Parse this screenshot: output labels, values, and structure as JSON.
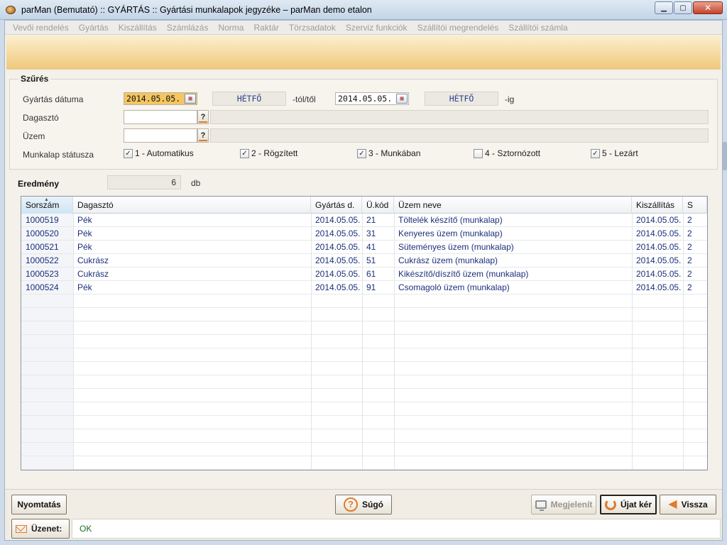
{
  "window": {
    "title": "parMan (Bemutató) :: GYÁRTÁS :: Gyártási munkalapok jegyzéke   –   parMan demo etalon",
    "minimize": "▁",
    "maximize": "▢",
    "close": "✕"
  },
  "menu": [
    "Vevői rendelés",
    "Gyártás",
    "Kiszállítás",
    "Számlázás",
    "Norma",
    "Raktár",
    "Törzsadatok",
    "Szerviz funkciók",
    "Szállítói megrendelés",
    "Szállítói számla"
  ],
  "filter": {
    "title": "Szűrés",
    "date_label": "Gyártás dátuma",
    "date_from": "2014.05.05.",
    "day_from": "HÉTFŐ",
    "from_suffix": "-tól/től",
    "date_to": "2014.05.05.",
    "day_to": "HÉTFŐ",
    "to_suffix": "-ig",
    "kneader_label": "Dagasztó",
    "kneader_value": "",
    "plant_label": "Üzem",
    "plant_value": "",
    "lookup_button": "?",
    "status_label": "Munkalap státusza",
    "statuses": [
      {
        "label": "1 - Automatikus",
        "checked": true
      },
      {
        "label": "2 - Rögzített",
        "checked": true
      },
      {
        "label": "3 - Munkában",
        "checked": true
      },
      {
        "label": "4 - Sztornózott",
        "checked": false
      },
      {
        "label": "5 - Lezárt",
        "checked": true
      }
    ]
  },
  "result": {
    "label": "Eredmény",
    "count": "6",
    "unit": "db"
  },
  "table": {
    "columns": [
      "Sorszám",
      "Dagasztó",
      "Gyártás d.",
      "Ü.kód",
      "Üzem neve",
      "Kiszállítás",
      "S"
    ],
    "rows": [
      [
        "1000519",
        "Pék",
        "2014.05.05.",
        "21",
        "Töltelék készítő (munkalap)",
        "2014.05.05.",
        "2"
      ],
      [
        "1000520",
        "Pék",
        "2014.05.05.",
        "31",
        "Kenyeres üzem (munkalap)",
        "2014.05.05.",
        "2"
      ],
      [
        "1000521",
        "Pék",
        "2014.05.05.",
        "41",
        "Süteményes üzem (munkalap)",
        "2014.05.05.",
        "2"
      ],
      [
        "1000522",
        "Cukrász",
        "2014.05.05.",
        "51",
        "Cukrász üzem (munkalap)",
        "2014.05.05.",
        "2"
      ],
      [
        "1000523",
        "Cukrász",
        "2014.05.05.",
        "61",
        "Kikészítő/díszítő üzem (munkalap)",
        "2014.05.05.",
        "2"
      ],
      [
        "1000524",
        "Pék",
        "2014.05.05.",
        "91",
        "Csomagoló üzem (munkalap)",
        "2014.05.05.",
        "2"
      ]
    ],
    "sorted_column": "Sorszám"
  },
  "buttons": {
    "print": "Nyomtatás",
    "help": "Súgó",
    "show": "Megjelenít",
    "refresh": "Újat kér",
    "back": "Vissza"
  },
  "status": {
    "label": "Üzenet:",
    "message": "OK"
  }
}
